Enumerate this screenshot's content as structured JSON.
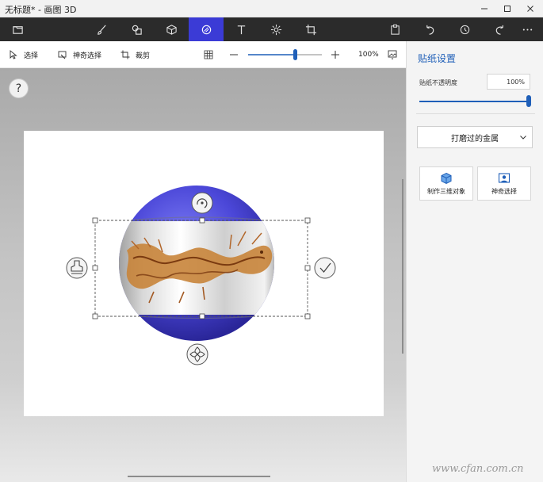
{
  "window": {
    "title": "无标题* - 画图 3D",
    "controls": [
      "minimize-icon",
      "maximize-icon",
      "close-icon"
    ]
  },
  "toolbar": {
    "left_icon": "menu-folder-icon",
    "tools": [
      "brush-icon",
      "2d-shapes-icon",
      "3d-objects-icon",
      "stickers-icon",
      "text-icon",
      "effects-icon",
      "canvas-icon"
    ],
    "active_tool": "stickers-icon",
    "right_icons": [
      "paste-icon",
      "undo-icon",
      "history-icon",
      "redo-icon",
      "more-icon"
    ],
    "accent": "#3b3bd6"
  },
  "subtoolbar": {
    "select_label": "选择",
    "magic_select_label": "神奇选择",
    "crop_label": "裁剪",
    "zoom_label": "100%",
    "zoom_fraction": 0.65
  },
  "canvas": {
    "help_label": "?"
  },
  "panel": {
    "title": "贴纸设置",
    "opacity_label": "贴纸不透明度",
    "opacity_value": "100%",
    "opacity_fraction": 1.0,
    "material_dropdown": "打磨过的金属",
    "make_3d_label": "制作三维对象",
    "magic_select_label": "神奇选择",
    "accent": "#1f5fb8"
  },
  "watermark": "www.cfan.com.cn"
}
